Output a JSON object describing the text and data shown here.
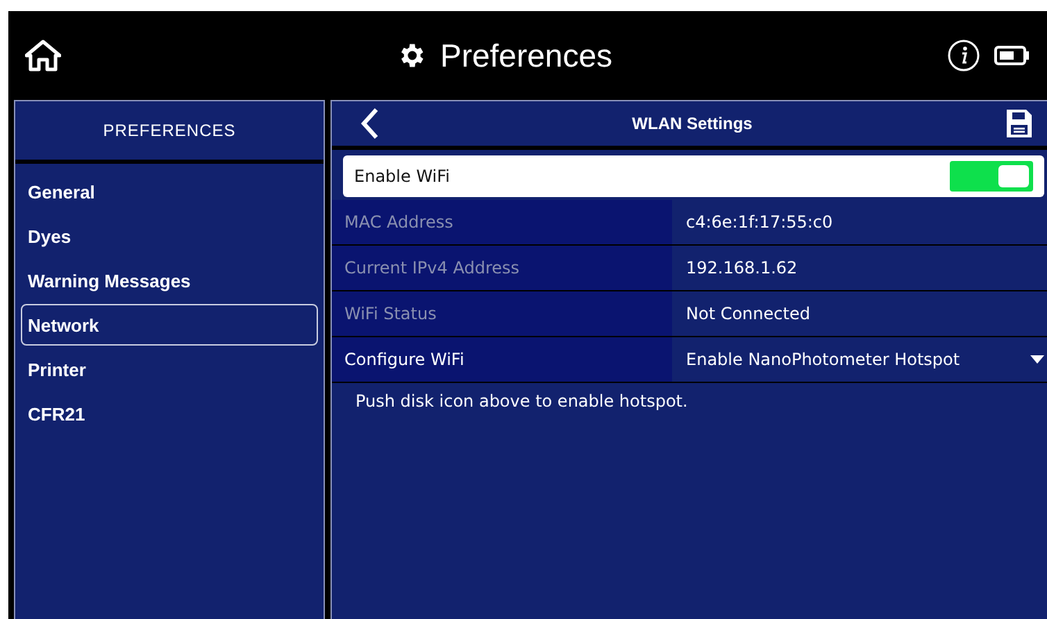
{
  "header": {
    "title": "Preferences"
  },
  "sidebar": {
    "title": "PREFERENCES",
    "items": [
      {
        "label": "General",
        "selected": false
      },
      {
        "label": "Dyes",
        "selected": false
      },
      {
        "label": "Warning Messages",
        "selected": false
      },
      {
        "label": "Network",
        "selected": true
      },
      {
        "label": "Printer",
        "selected": false
      },
      {
        "label": "CFR21",
        "selected": false
      }
    ]
  },
  "panel": {
    "title": "WLAN Settings",
    "toggle": {
      "label": "Enable WiFi",
      "on": true
    },
    "rows": [
      {
        "kind": "info",
        "label": "MAC Address",
        "value": "c4:6e:1f:17:55:c0",
        "disabled": true
      },
      {
        "kind": "info",
        "label": "Current IPv4 Address",
        "value": "192.168.1.62",
        "disabled": true
      },
      {
        "kind": "info",
        "label": "WiFi Status",
        "value": "Not Connected",
        "disabled": true
      },
      {
        "kind": "dropdown",
        "label": "Configure WiFi",
        "value": "Enable NanoPhotometer Hotspot",
        "disabled": false
      }
    ],
    "note": "Push disk icon above to enable hotspot."
  }
}
